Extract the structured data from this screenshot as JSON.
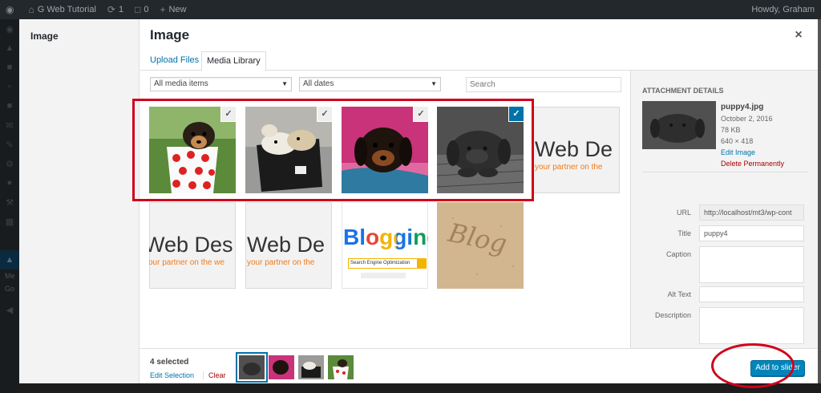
{
  "adminbar": {
    "site_name": "G Web Tutorial",
    "updates_count": "1",
    "comments_count": "0",
    "new_label": "New",
    "greeting": "Howdy, Graham"
  },
  "adminmenu": {
    "partial_label_1": "Me",
    "partial_label_2": "Go"
  },
  "modal": {
    "menu_title": "Image",
    "frame_title": "Image",
    "close_label": "×",
    "tabs": [
      {
        "label": "Upload Files",
        "active": false
      },
      {
        "label": "Media Library",
        "active": true
      }
    ],
    "filters": {
      "media_type": "All media items",
      "dates": "All dates",
      "search_placeholder": "Search"
    }
  },
  "attachments": [
    {
      "name": "puppy1",
      "state": "selected",
      "check": "✓"
    },
    {
      "name": "puppy2",
      "state": "selected",
      "check": "✓"
    },
    {
      "name": "puppy3",
      "state": "selected",
      "check": "✓"
    },
    {
      "name": "puppy4",
      "state": "details",
      "check": "✓"
    },
    {
      "name": "web-design-logo",
      "text": "Web De",
      "tagline": "your partner on the"
    },
    {
      "name": "web-design-logo",
      "text": "Web Des",
      "tagline": "your partner on the we"
    },
    {
      "name": "web-design-logo",
      "text": "Web De",
      "tagline": "your partner on the"
    },
    {
      "name": "blogging-image",
      "text": "Blogging",
      "search_text": "Search Engine Optimization"
    },
    {
      "name": "blog-sand-image",
      "text": "Blog"
    }
  ],
  "details": {
    "heading": "ATTACHMENT DETAILS",
    "filename": "puppy4.jpg",
    "date": "October 2, 2016",
    "size": "78 KB",
    "dimensions": "640 × 418",
    "edit_label": "Edit Image",
    "delete_label": "Delete Permanently",
    "fields": {
      "url_label": "URL",
      "url_value": "http://localhost/mt3/wp-cont",
      "title_label": "Title",
      "title_value": "puppy4",
      "caption_label": "Caption",
      "alt_label": "Alt Text",
      "description_label": "Description"
    }
  },
  "selection": {
    "count_text": "4 selected",
    "edit_label": "Edit Selection",
    "clear_label": "Clear"
  },
  "insert_button": "Add to slider",
  "colors": {
    "accent": "#0073aa",
    "primary_button": "#0085ba",
    "highlight": "#d0021b"
  }
}
